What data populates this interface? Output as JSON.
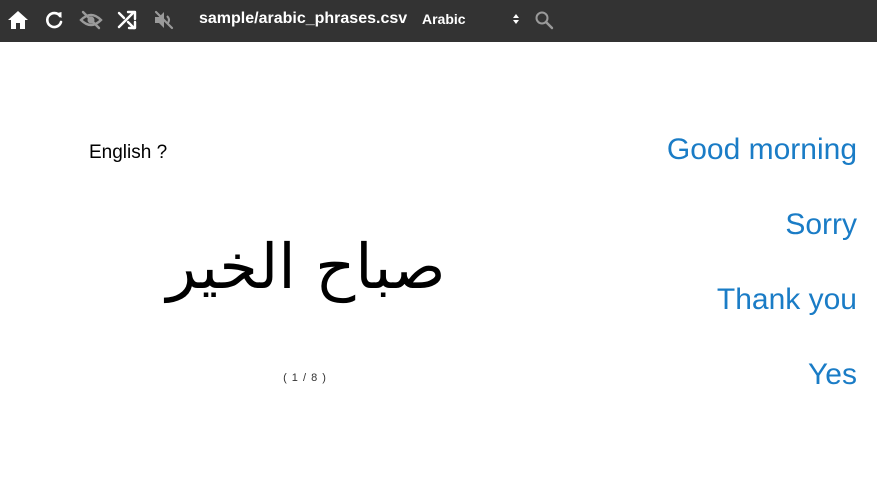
{
  "toolbar": {
    "icons": [
      "home-icon",
      "refresh-icon",
      "eye-off-icon",
      "shuffle-icon",
      "mute-icon",
      "search-icon"
    ],
    "filename": "sample/arabic_phrases.csv",
    "language_select": {
      "selected": "Arabic"
    }
  },
  "card": {
    "prompt_label": "English ?",
    "phrase": "صباح الخير",
    "counter": "( 1 / 8 )"
  },
  "choices": [
    "Good morning",
    "Sorry",
    "Thank you",
    "Yes"
  ],
  "colors": {
    "toolbar_bg": "#333333",
    "choice_text": "#1a7cc6",
    "icon": "#ffffff",
    "icon_dim": "#9a9a9a"
  }
}
